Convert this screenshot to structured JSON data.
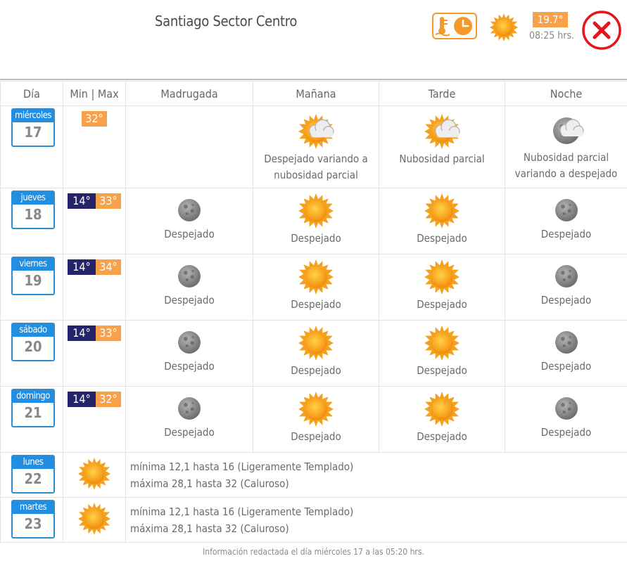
{
  "header": {
    "title": "Santiago Sector Centro",
    "current_temp": "19.7°",
    "current_time": "08:25 hrs."
  },
  "columns": [
    "Día",
    "Min | Max",
    "Madrugada",
    "Mañana",
    "Tarde",
    "Noche"
  ],
  "first_day": {
    "weekday": "miércoles",
    "day": "17",
    "max": "32°",
    "morning": "Despejado variando a nubosidad parcial",
    "afternoon": "Nubosidad parcial",
    "night": "Nubosidad parcial variando a despejado"
  },
  "days": [
    {
      "weekday": "jueves",
      "day": "18",
      "min": "14°",
      "max": "33°",
      "dawn": "Despejado",
      "morning": "Despejado",
      "afternoon": "Despejado",
      "night": "Despejado"
    },
    {
      "weekday": "viernes",
      "day": "19",
      "min": "14°",
      "max": "34°",
      "dawn": "Despejado",
      "morning": "Despejado",
      "afternoon": "Despejado",
      "night": "Despejado"
    },
    {
      "weekday": "sábado",
      "day": "20",
      "min": "14°",
      "max": "33°",
      "dawn": "Despejado",
      "morning": "Despejado",
      "afternoon": "Despejado",
      "night": "Despejado"
    },
    {
      "weekday": "domingo",
      "day": "21",
      "min": "14°",
      "max": "32°",
      "dawn": "Despejado",
      "morning": "Despejado",
      "afternoon": "Despejado",
      "night": "Despejado"
    }
  ],
  "summary_days": [
    {
      "weekday": "lunes",
      "day": "22",
      "line1": "mínima 12,1 hasta 16 (Ligeramente Templado)",
      "line2": "máxima 28,1 hasta 32 (Caluroso)"
    },
    {
      "weekday": "martes",
      "day": "23",
      "line1": "mínima 12,1 hasta 16 (Ligeramente Templado)",
      "line2": "máxima 28,1 hasta 32 (Caluroso)"
    }
  ],
  "footer": "Información redactada el día miércoles 17 a las 05:20 hrs.",
  "colors": {
    "accent_orange": "#f9a04a",
    "calendar_blue": "#1f8ee3",
    "min_navy": "#25246a",
    "close_red": "#e8141c"
  },
  "icons": {
    "sun": "sun-icon",
    "moon": "moon-icon",
    "sun_cloud": "sun-cloud-icon",
    "moon_cloud": "moon-cloud-icon",
    "close": "close-icon",
    "thermometer_clock": "thermometer-clock-icon"
  }
}
